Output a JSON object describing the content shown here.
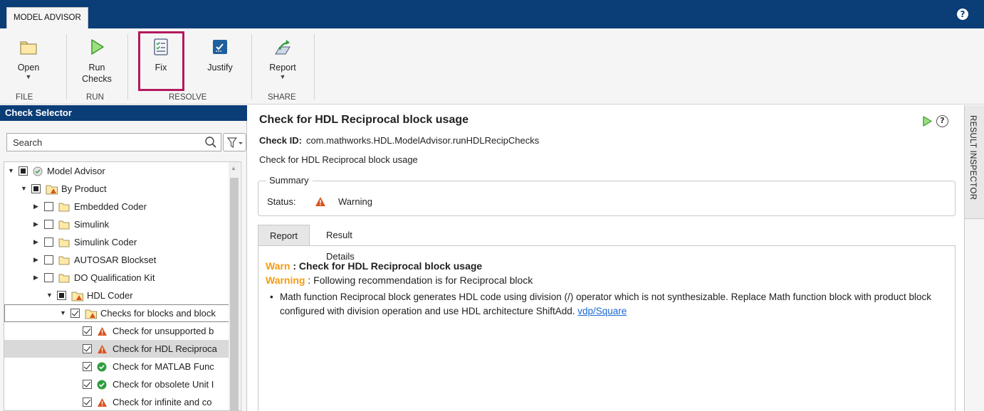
{
  "app": {
    "tab_label": "MODEL ADVISOR"
  },
  "toolstrip": {
    "open": "Open",
    "run_checks": "Run\nChecks",
    "fix": "Fix",
    "justify": "Justify",
    "report": "Report",
    "groups": {
      "file": "FILE",
      "run": "RUN",
      "resolve": "RESOLVE",
      "share": "SHARE"
    }
  },
  "left_panel": {
    "title": "Check Selector",
    "search_placeholder": "Search",
    "tree": [
      {
        "label": "Model Advisor"
      },
      {
        "label": "By Product"
      },
      {
        "label": "Embedded Coder"
      },
      {
        "label": "Simulink"
      },
      {
        "label": "Simulink Coder"
      },
      {
        "label": "AUTOSAR Blockset"
      },
      {
        "label": "DO Qualification Kit"
      },
      {
        "label": "HDL Coder"
      },
      {
        "label": "Checks for blocks and block"
      },
      {
        "label": "Check for unsupported b"
      },
      {
        "label": "Check for HDL Reciproca"
      },
      {
        "label": "Check for MATLAB Func"
      },
      {
        "label": "Check for obsolete Unit I"
      },
      {
        "label": "Check for infinite and co"
      }
    ]
  },
  "main": {
    "title": "Check for HDL Reciprocal block usage",
    "check_id_label": "Check ID:",
    "check_id": "com.mathworks.HDL.ModelAdvisor.runHDLRecipChecks",
    "description": "Check for HDL Reciprocal block usage",
    "summary": {
      "legend": "Summary",
      "status_label": "Status:",
      "status_value": "Warning"
    },
    "tabs": [
      "Report",
      "Result Details"
    ],
    "report": {
      "warn_prefix": "Warn",
      "warn_text": " : Check for HDL Reciprocal block usage",
      "warning_prefix": "Warning",
      "warning_text": " : Following recommendation is for Reciprocal block",
      "bullet_text": "Math function Reciprocal block generates HDL code using division (/) operator which is not synthesizable. Replace Math function block with product block configured with division operation and use HDL architecture ShiftAdd. ",
      "link": "vdp/Square"
    }
  },
  "inspector": {
    "label": "RESULT INSPECTOR"
  },
  "colors": {
    "header_blue": "#0b3d77",
    "warning_orange": "#f39c12",
    "highlight_magenta": "#b3195d",
    "link_blue": "#1a66d2",
    "pass_green": "#2e9e3e"
  }
}
